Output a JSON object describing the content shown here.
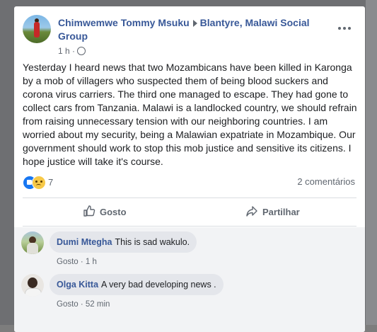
{
  "post": {
    "author": "Chimwemwe Tommy Msuku",
    "group_line1": "Blantyre, Malawi Social",
    "group_line2": "Group",
    "time": "1 h ·",
    "body": "Yesterday I heard news that two Mozambicans have been killed in Karonga by a mob of villagers who suspected them of being blood suckers and corona virus carriers. The third one managed to escape. They had gone to collect cars from Tanzania. Malawi is a landlocked country, we should refrain from raising unnecessary tension with our neighboring countries. I am worried about my security, being a Malawian expatriate in Mozambique. Our government should work to stop this mob justice and sensitive its citizens. I hope justice will take it's course."
  },
  "reactions": {
    "count": "7",
    "types": [
      "like-icon",
      "sad-icon"
    ],
    "comments_label": "2 comentários"
  },
  "actions": {
    "like": "Gosto",
    "share": "Partilhar"
  },
  "comments": [
    {
      "name": "Dumi Mtegha",
      "text": "This is sad wakulo.",
      "like": "Gosto",
      "time": "· 1 h"
    },
    {
      "name": "Olga Kitta",
      "text": "A very bad developing news .",
      "like": "Gosto",
      "time": "· 52 min"
    }
  ],
  "colors": {
    "link": "#385898",
    "like_blue": "#1877f2",
    "text": "#1c1e21",
    "muted": "#606770"
  }
}
